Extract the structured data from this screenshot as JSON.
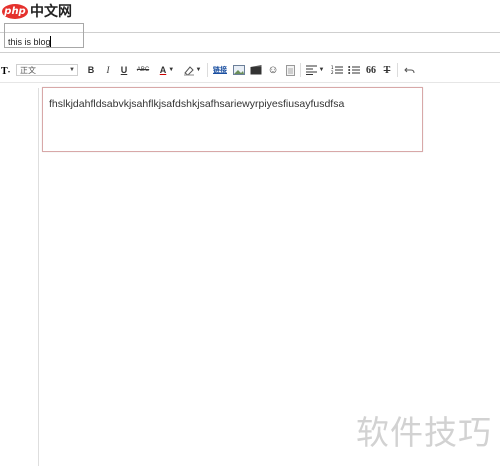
{
  "watermark_logo": {
    "badge": "php",
    "text": "中文网"
  },
  "title_input": {
    "value": "this is blog"
  },
  "toolbar": {
    "paragraph_select": "正文",
    "bold": "B",
    "italic": "I",
    "underline": "U",
    "strike": "ABC",
    "font_color": "A",
    "link_label": "链接",
    "quote": "66",
    "clear_format": "T"
  },
  "editor": {
    "content": "fhslkjdahfldsabvkjsahflkjsafdshkjsafhsariewyrpiyesfiusayfusdfsa"
  },
  "watermark_text": "软件技巧"
}
